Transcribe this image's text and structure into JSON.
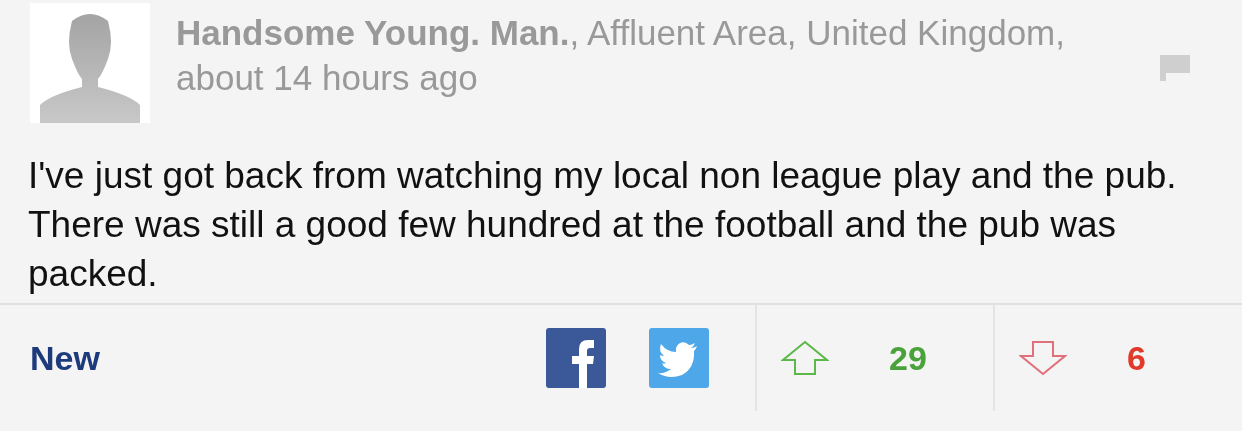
{
  "comment": {
    "byline": "**Handsome Young. Man.**, Affluent Area, United Kingdom, about 14 hours ago",
    "text": "I've just got back from watching my local non league play and the pub. There was still a good few hundred at the football and the pub was packed."
  },
  "footer": {
    "label": "New",
    "upvotes": "29",
    "downvotes": "6"
  }
}
